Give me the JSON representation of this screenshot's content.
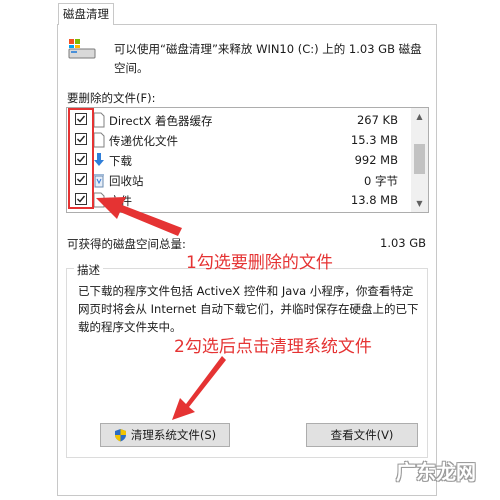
{
  "tab": {
    "label": "磁盘清理"
  },
  "intro": {
    "text": "可以使用“磁盘清理”来释放 WIN10 (C:) 上的 1.03 GB 磁盘空间。"
  },
  "files": {
    "label": "要删除的文件(F):",
    "items": [
      {
        "name": "DirectX 着色器缓存",
        "size": "267 KB",
        "checked": true,
        "icon": "document-icon"
      },
      {
        "name": "传递优化文件",
        "size": "15.3 MB",
        "checked": true,
        "icon": "document-icon"
      },
      {
        "name": "下载",
        "size": "992 MB",
        "checked": true,
        "icon": "download-arrow-icon"
      },
      {
        "name": "回收站",
        "size": "0 字节",
        "checked": true,
        "icon": "recycle-bin-icon"
      },
      {
        "name": "文件",
        "size": "13.8 MB",
        "checked": true,
        "icon": "document-icon"
      }
    ]
  },
  "total": {
    "label": "可获得的磁盘空间总量:",
    "value": "1.03 GB"
  },
  "description": {
    "label": "描述",
    "text": "已下载的程序文件包括 ActiveX 控件和 Java 小程序，你查看特定网页时将会从 Internet 自动下载它们，并临时保存在硬盘上的已下载的程序文件夹中。"
  },
  "buttons": {
    "cleanup_system": "清理系统文件(S)",
    "view_files": "查看文件(V)"
  },
  "annotations": {
    "step1": "1勾选要删除的文件",
    "step2": "2勾选后点击清理系统文件"
  },
  "watermark": {
    "text": "广东龙网"
  },
  "colors": {
    "annotation": "#e53333",
    "button": "#e1e1e1",
    "border": "#adadad"
  }
}
